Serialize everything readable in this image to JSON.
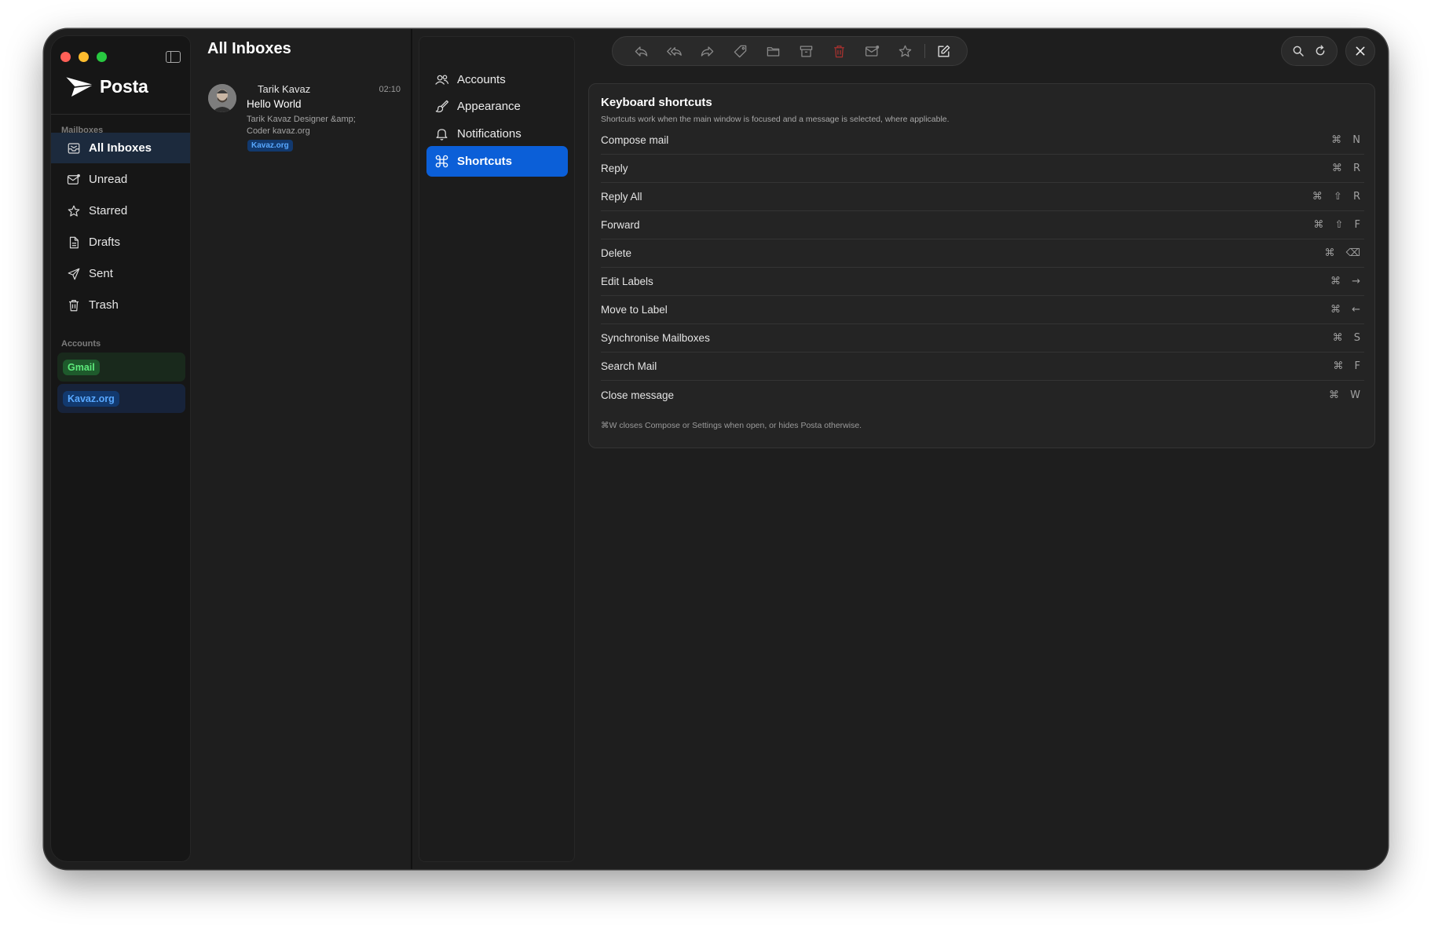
{
  "app": {
    "name": "Posta"
  },
  "sidebar": {
    "mailboxes_label": "Mailboxes",
    "items": [
      {
        "label": "All Inboxes",
        "icon": "inbox-icon"
      },
      {
        "label": "Unread",
        "icon": "envelope-icon"
      },
      {
        "label": "Starred",
        "icon": "star-icon"
      },
      {
        "label": "Drafts",
        "icon": "document-icon"
      },
      {
        "label": "Sent",
        "icon": "paper-plane-icon"
      },
      {
        "label": "Trash",
        "icon": "trash-icon"
      }
    ],
    "accounts_label": "Accounts",
    "accounts": [
      {
        "label": "Gmail",
        "color": "#5dea7b"
      },
      {
        "label": "Kavaz.org",
        "color": "#58a8ff"
      }
    ]
  },
  "message_list": {
    "title": "All Inboxes",
    "messages": [
      {
        "sender": "Tarik Kavaz",
        "time": "02:10",
        "subject": "Hello World",
        "preview": "Tarik Kavaz Designer &amp; Coder kavaz.org",
        "tag": "Kavaz.org"
      }
    ]
  },
  "settings_nav": {
    "items": [
      {
        "label": "Accounts",
        "icon": "users-icon"
      },
      {
        "label": "Appearance",
        "icon": "paintbrush-icon"
      },
      {
        "label": "Notifications",
        "icon": "bell-icon"
      },
      {
        "label": "Shortcuts",
        "icon": "command-icon",
        "active": true
      }
    ]
  },
  "toolbar": {
    "buttons": [
      "reply-icon",
      "reply-all-icon",
      "forward-icon",
      "tag-icon",
      "folder-icon",
      "archive-icon",
      "trash-icon",
      "mark-unread-icon",
      "star-icon",
      "compose-icon"
    ],
    "right": [
      "search-icon",
      "refresh-icon",
      "close-icon"
    ]
  },
  "shortcuts": {
    "title": "Keyboard shortcuts",
    "subtitle": "Shortcuts work when the main window is focused and a message is selected, where applicable.",
    "rows": [
      {
        "label": "Compose mail",
        "keys": "⌘ N"
      },
      {
        "label": "Reply",
        "keys": "⌘ R"
      },
      {
        "label": "Reply All",
        "keys": "⌘ ⇧ R"
      },
      {
        "label": "Forward",
        "keys": "⌘ ⇧ F"
      },
      {
        "label": "Delete",
        "keys": "⌘ ⌫"
      },
      {
        "label": "Edit Labels",
        "keys": "⌘ →"
      },
      {
        "label": "Move to Label",
        "keys": "⌘ ←"
      },
      {
        "label": "Synchronise Mailboxes",
        "keys": "⌘ S"
      },
      {
        "label": "Search Mail",
        "keys": "⌘ F"
      },
      {
        "label": "Close message",
        "keys": "⌘ W"
      }
    ],
    "footnote": "⌘W closes Compose or Settings when open, or hides Posta otherwise."
  },
  "colors": {
    "accent": "#0b5fd8",
    "danger": "#e5484d"
  }
}
